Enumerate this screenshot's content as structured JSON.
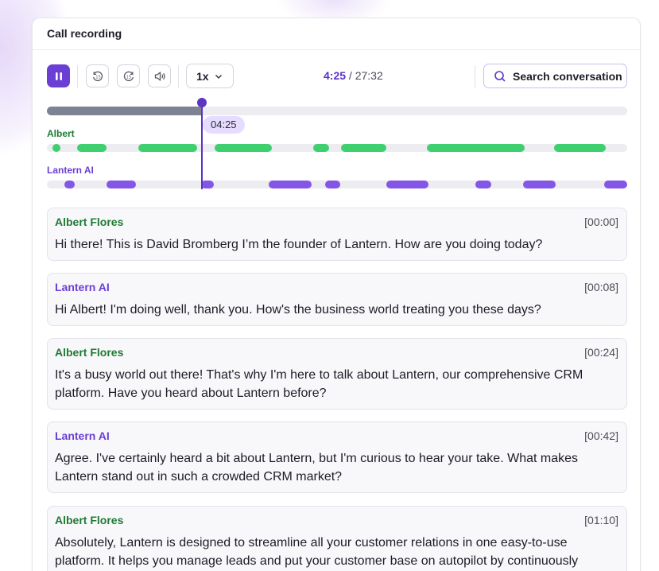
{
  "card": {
    "title": "Call recording"
  },
  "colors": {
    "accent": "#6b3fd4",
    "speaker_human": "#3ecf6e",
    "speaker_ai": "#8456e8",
    "human_label": "#1e7a33",
    "ai_label": "#6b3fd4"
  },
  "player": {
    "pause_icon": "pause-icon",
    "rewind_icon": "rewind-15-icon",
    "forward_icon": "forward-15-icon",
    "volume_icon": "volume-icon",
    "speed": "1x",
    "current_time": "4:25",
    "total_time": "27:32",
    "search_label": "Search conversation",
    "playhead_label": "04:25",
    "progress_fraction": 0.2676
  },
  "timeline": {
    "speakers": [
      {
        "name": "Albert",
        "kind": "human",
        "segments": [
          [
            0.01,
            0.024
          ],
          [
            0.052,
            0.102
          ],
          [
            0.157,
            0.258
          ],
          [
            0.289,
            0.388
          ],
          [
            0.459,
            0.487
          ],
          [
            0.507,
            0.585
          ],
          [
            0.655,
            0.824
          ],
          [
            0.874,
            0.963
          ]
        ]
      },
      {
        "name": "Lantern AI",
        "kind": "ai",
        "segments": [
          [
            0.03,
            0.048
          ],
          [
            0.103,
            0.153
          ],
          [
            0.266,
            0.288
          ],
          [
            0.382,
            0.456
          ],
          [
            0.479,
            0.505
          ],
          [
            0.585,
            0.658
          ],
          [
            0.739,
            0.767
          ],
          [
            0.821,
            0.877
          ],
          [
            0.96,
            1.0
          ]
        ]
      }
    ]
  },
  "messages": [
    {
      "speaker": "Albert Flores",
      "kind": "human",
      "time": "[00:00]",
      "text": "Hi there! This is David Bromberg I’m the founder of Lantern. How are you doing today?"
    },
    {
      "speaker": "Lantern AI",
      "kind": "ai",
      "time": "[00:08]",
      "text": "Hi Albert! I'm doing well, thank you. How's the business world treating you these days?"
    },
    {
      "speaker": "Albert Flores",
      "kind": "human",
      "time": "[00:24]",
      "text": "It's a busy world out there! That's why I'm here to talk about Lantern, our comprehensive CRM platform. Have you heard about Lantern before?"
    },
    {
      "speaker": "Lantern AI",
      "kind": "ai",
      "time": "[00:42]",
      "text": "Agree. I've certainly heard a bit about Lantern, but I'm curious to hear your take. What makes Lantern stand out in such a crowded CRM market?"
    },
    {
      "speaker": "Albert Flores",
      "kind": "human",
      "time": "[01:10]",
      "text": "Absolutely, Lantern is designed to streamline all your customer relations in one easy-to-use platform. It helps you manage leads and put your customer base on autopilot by continuously"
    }
  ]
}
